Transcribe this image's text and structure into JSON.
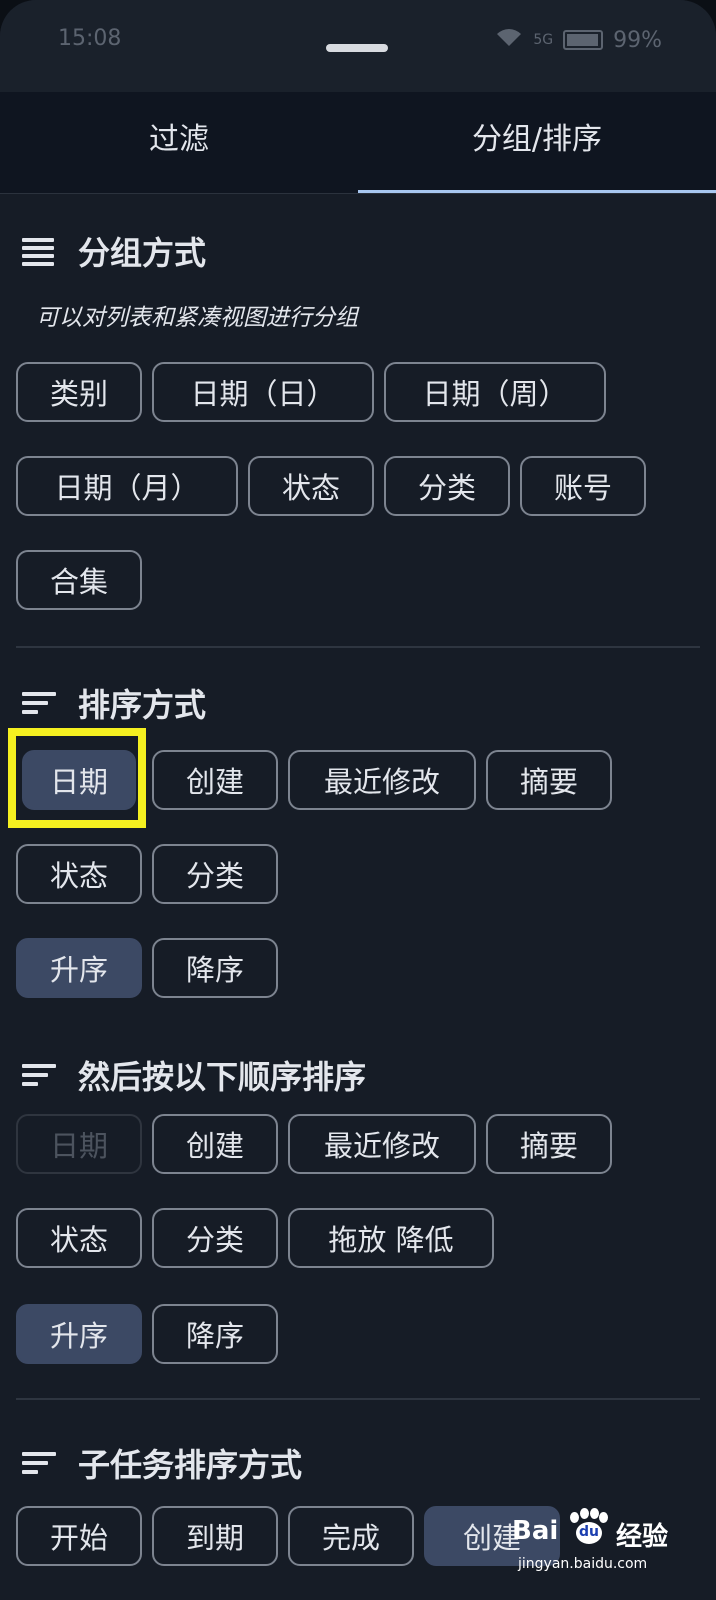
{
  "status_bar": {
    "time": "15:08",
    "battery": "99%",
    "network": "5G"
  },
  "tabs": [
    {
      "label": "过滤",
      "active": false
    },
    {
      "label": "分组/排序",
      "active": true
    }
  ],
  "group_section": {
    "title": "分组方式",
    "subtitle": "可以对列表和紧凑视图进行分组",
    "options": [
      "类别",
      "日期（日）",
      "日期（周）",
      "日期（月）",
      "状态",
      "分类",
      "账号",
      "合集"
    ]
  },
  "sort_section": {
    "title": "排序方式",
    "options": [
      "日期",
      "创建",
      "最近修改",
      "摘要",
      "状态",
      "分类"
    ],
    "selected": "日期",
    "order_options": [
      "升序",
      "降序"
    ],
    "order_selected": "升序"
  },
  "then_sort_section": {
    "title": "然后按以下顺序排序",
    "options": [
      "日期",
      "创建",
      "最近修改",
      "摘要",
      "状态",
      "分类",
      "拖放 降低"
    ],
    "disabled": "日期",
    "order_options": [
      "升序",
      "降序"
    ],
    "order_selected": "升序"
  },
  "subtask_section": {
    "title": "子任务排序方式",
    "options": [
      "开始",
      "到期",
      "完成",
      "创建"
    ],
    "selected": "创建"
  },
  "watermark": {
    "logo": "Bai",
    "logo2": "du",
    "text": "经验",
    "url": "jingyan.baidu.com"
  },
  "colors": {
    "background": "#161c26",
    "selected_chip": "#3c4964",
    "tab_indicator": "#a8c7f0",
    "highlight": "#f5f020"
  }
}
